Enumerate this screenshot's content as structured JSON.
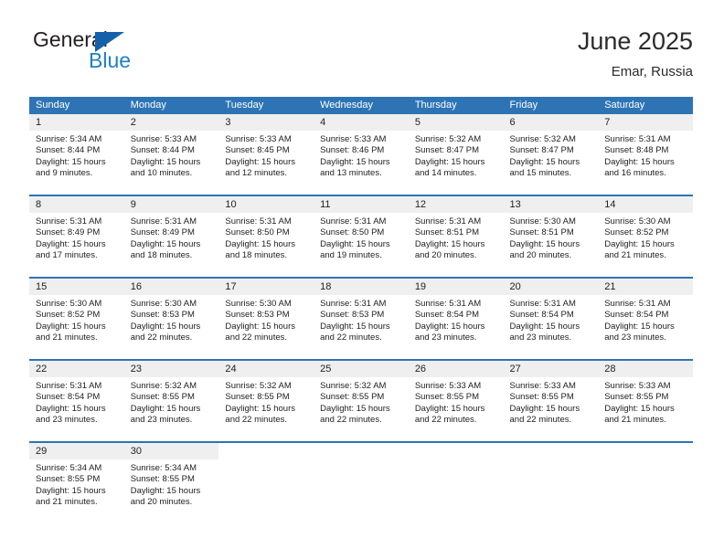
{
  "logo": {
    "word_top": "General",
    "word_bottom": "Blue",
    "triangle_color": "#1561a9",
    "blue_color": "#1f7fc4"
  },
  "header": {
    "title": "June 2025",
    "location": "Emar, Russia"
  },
  "theme": {
    "header_blue": "#2e74b5",
    "day_band_gray": "#efefef",
    "text": "#222222"
  },
  "weekdays": [
    "Sunday",
    "Monday",
    "Tuesday",
    "Wednesday",
    "Thursday",
    "Friday",
    "Saturday"
  ],
  "weeks": [
    [
      {
        "day": "1",
        "sunrise": "Sunrise: 5:34 AM",
        "sunset": "Sunset: 8:44 PM",
        "daylight_line1": "Daylight: 15 hours",
        "daylight_line2": "and 9 minutes."
      },
      {
        "day": "2",
        "sunrise": "Sunrise: 5:33 AM",
        "sunset": "Sunset: 8:44 PM",
        "daylight_line1": "Daylight: 15 hours",
        "daylight_line2": "and 10 minutes."
      },
      {
        "day": "3",
        "sunrise": "Sunrise: 5:33 AM",
        "sunset": "Sunset: 8:45 PM",
        "daylight_line1": "Daylight: 15 hours",
        "daylight_line2": "and 12 minutes."
      },
      {
        "day": "4",
        "sunrise": "Sunrise: 5:33 AM",
        "sunset": "Sunset: 8:46 PM",
        "daylight_line1": "Daylight: 15 hours",
        "daylight_line2": "and 13 minutes."
      },
      {
        "day": "5",
        "sunrise": "Sunrise: 5:32 AM",
        "sunset": "Sunset: 8:47 PM",
        "daylight_line1": "Daylight: 15 hours",
        "daylight_line2": "and 14 minutes."
      },
      {
        "day": "6",
        "sunrise": "Sunrise: 5:32 AM",
        "sunset": "Sunset: 8:47 PM",
        "daylight_line1": "Daylight: 15 hours",
        "daylight_line2": "and 15 minutes."
      },
      {
        "day": "7",
        "sunrise": "Sunrise: 5:31 AM",
        "sunset": "Sunset: 8:48 PM",
        "daylight_line1": "Daylight: 15 hours",
        "daylight_line2": "and 16 minutes."
      }
    ],
    [
      {
        "day": "8",
        "sunrise": "Sunrise: 5:31 AM",
        "sunset": "Sunset: 8:49 PM",
        "daylight_line1": "Daylight: 15 hours",
        "daylight_line2": "and 17 minutes."
      },
      {
        "day": "9",
        "sunrise": "Sunrise: 5:31 AM",
        "sunset": "Sunset: 8:49 PM",
        "daylight_line1": "Daylight: 15 hours",
        "daylight_line2": "and 18 minutes."
      },
      {
        "day": "10",
        "sunrise": "Sunrise: 5:31 AM",
        "sunset": "Sunset: 8:50 PM",
        "daylight_line1": "Daylight: 15 hours",
        "daylight_line2": "and 18 minutes."
      },
      {
        "day": "11",
        "sunrise": "Sunrise: 5:31 AM",
        "sunset": "Sunset: 8:50 PM",
        "daylight_line1": "Daylight: 15 hours",
        "daylight_line2": "and 19 minutes."
      },
      {
        "day": "12",
        "sunrise": "Sunrise: 5:31 AM",
        "sunset": "Sunset: 8:51 PM",
        "daylight_line1": "Daylight: 15 hours",
        "daylight_line2": "and 20 minutes."
      },
      {
        "day": "13",
        "sunrise": "Sunrise: 5:30 AM",
        "sunset": "Sunset: 8:51 PM",
        "daylight_line1": "Daylight: 15 hours",
        "daylight_line2": "and 20 minutes."
      },
      {
        "day": "14",
        "sunrise": "Sunrise: 5:30 AM",
        "sunset": "Sunset: 8:52 PM",
        "daylight_line1": "Daylight: 15 hours",
        "daylight_line2": "and 21 minutes."
      }
    ],
    [
      {
        "day": "15",
        "sunrise": "Sunrise: 5:30 AM",
        "sunset": "Sunset: 8:52 PM",
        "daylight_line1": "Daylight: 15 hours",
        "daylight_line2": "and 21 minutes."
      },
      {
        "day": "16",
        "sunrise": "Sunrise: 5:30 AM",
        "sunset": "Sunset: 8:53 PM",
        "daylight_line1": "Daylight: 15 hours",
        "daylight_line2": "and 22 minutes."
      },
      {
        "day": "17",
        "sunrise": "Sunrise: 5:30 AM",
        "sunset": "Sunset: 8:53 PM",
        "daylight_line1": "Daylight: 15 hours",
        "daylight_line2": "and 22 minutes."
      },
      {
        "day": "18",
        "sunrise": "Sunrise: 5:31 AM",
        "sunset": "Sunset: 8:53 PM",
        "daylight_line1": "Daylight: 15 hours",
        "daylight_line2": "and 22 minutes."
      },
      {
        "day": "19",
        "sunrise": "Sunrise: 5:31 AM",
        "sunset": "Sunset: 8:54 PM",
        "daylight_line1": "Daylight: 15 hours",
        "daylight_line2": "and 23 minutes."
      },
      {
        "day": "20",
        "sunrise": "Sunrise: 5:31 AM",
        "sunset": "Sunset: 8:54 PM",
        "daylight_line1": "Daylight: 15 hours",
        "daylight_line2": "and 23 minutes."
      },
      {
        "day": "21",
        "sunrise": "Sunrise: 5:31 AM",
        "sunset": "Sunset: 8:54 PM",
        "daylight_line1": "Daylight: 15 hours",
        "daylight_line2": "and 23 minutes."
      }
    ],
    [
      {
        "day": "22",
        "sunrise": "Sunrise: 5:31 AM",
        "sunset": "Sunset: 8:54 PM",
        "daylight_line1": "Daylight: 15 hours",
        "daylight_line2": "and 23 minutes."
      },
      {
        "day": "23",
        "sunrise": "Sunrise: 5:32 AM",
        "sunset": "Sunset: 8:55 PM",
        "daylight_line1": "Daylight: 15 hours",
        "daylight_line2": "and 23 minutes."
      },
      {
        "day": "24",
        "sunrise": "Sunrise: 5:32 AM",
        "sunset": "Sunset: 8:55 PM",
        "daylight_line1": "Daylight: 15 hours",
        "daylight_line2": "and 22 minutes."
      },
      {
        "day": "25",
        "sunrise": "Sunrise: 5:32 AM",
        "sunset": "Sunset: 8:55 PM",
        "daylight_line1": "Daylight: 15 hours",
        "daylight_line2": "and 22 minutes."
      },
      {
        "day": "26",
        "sunrise": "Sunrise: 5:33 AM",
        "sunset": "Sunset: 8:55 PM",
        "daylight_line1": "Daylight: 15 hours",
        "daylight_line2": "and 22 minutes."
      },
      {
        "day": "27",
        "sunrise": "Sunrise: 5:33 AM",
        "sunset": "Sunset: 8:55 PM",
        "daylight_line1": "Daylight: 15 hours",
        "daylight_line2": "and 22 minutes."
      },
      {
        "day": "28",
        "sunrise": "Sunrise: 5:33 AM",
        "sunset": "Sunset: 8:55 PM",
        "daylight_line1": "Daylight: 15 hours",
        "daylight_line2": "and 21 minutes."
      }
    ],
    [
      {
        "day": "29",
        "sunrise": "Sunrise: 5:34 AM",
        "sunset": "Sunset: 8:55 PM",
        "daylight_line1": "Daylight: 15 hours",
        "daylight_line2": "and 21 minutes."
      },
      {
        "day": "30",
        "sunrise": "Sunrise: 5:34 AM",
        "sunset": "Sunset: 8:55 PM",
        "daylight_line1": "Daylight: 15 hours",
        "daylight_line2": "and 20 minutes."
      },
      {
        "day": "",
        "sunrise": "",
        "sunset": "",
        "daylight_line1": "",
        "daylight_line2": ""
      },
      {
        "day": "",
        "sunrise": "",
        "sunset": "",
        "daylight_line1": "",
        "daylight_line2": ""
      },
      {
        "day": "",
        "sunrise": "",
        "sunset": "",
        "daylight_line1": "",
        "daylight_line2": ""
      },
      {
        "day": "",
        "sunrise": "",
        "sunset": "",
        "daylight_line1": "",
        "daylight_line2": ""
      },
      {
        "day": "",
        "sunrise": "",
        "sunset": "",
        "daylight_line1": "",
        "daylight_line2": ""
      }
    ]
  ]
}
